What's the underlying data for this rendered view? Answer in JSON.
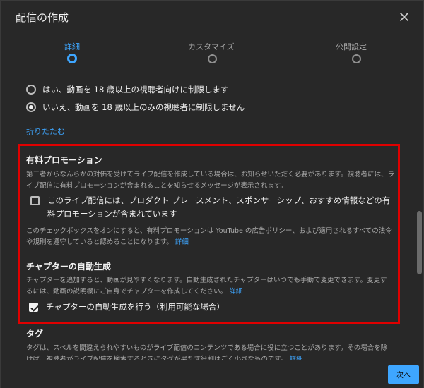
{
  "dialog": {
    "title": "配信の作成"
  },
  "stepper": {
    "steps": [
      {
        "label": "詳細"
      },
      {
        "label": "カスタマイズ"
      },
      {
        "label": "公開設定"
      }
    ],
    "active_step": 1
  },
  "age_restriction": {
    "options": [
      {
        "label": "はい、動画を 18 歳以上の視聴者向けに制限します",
        "checked": false
      },
      {
        "label": "いいえ、動画を 18 歳以上のみの視聴者に制限しません",
        "checked": true
      }
    ],
    "collapse_label": "折りたたむ"
  },
  "paid_promotion": {
    "title": "有料プロモーション",
    "description": "第三者からなんらかの対価を受けてライブ配信を作成している場合は、お知らせいただく必要があります。視聴者には、ライブ配信に有料プロモーションが含まれることを知らせるメッセージが表示されます。",
    "checkbox_label": "このライブ配信には、プロダクト プレースメント、スポンサーシップ、おすすめ情報などの有料プロモーションが含まれています",
    "checkbox_checked": false,
    "note": "このチェックボックスをオンにすると、有料プロモーションは YouTube の広告ポリシー、および適用されるすべての法令や規則を遵守していると認めることになります。",
    "details_link": "詳細"
  },
  "auto_chapters": {
    "title": "チャプターの自動生成",
    "description": "チャプターを追加すると、動画が見やすくなります。自動生成されたチャプターはいつでも手動で変更できます。変更するには、動画の説明欄にご自身でチャプターを作成してください。",
    "details_link": "詳細",
    "checkbox_label": "チャプターの自動生成を行う（利用可能な場合）",
    "checkbox_checked": true
  },
  "tags": {
    "title": "タグ",
    "description": "タグは、スペルを間違えられやすいものがライブ配信のコンテンツである場合に役に立つことがあります。その場合を除けば、視聴者がライブ配信を検索するときにタグが果たす役割はごく小さなものです。",
    "details_link": "詳細"
  },
  "footer": {
    "next_label": "次へ"
  },
  "colors": {
    "accent": "#3ea6ff",
    "highlight_border": "#e00000",
    "background": "#282828"
  }
}
